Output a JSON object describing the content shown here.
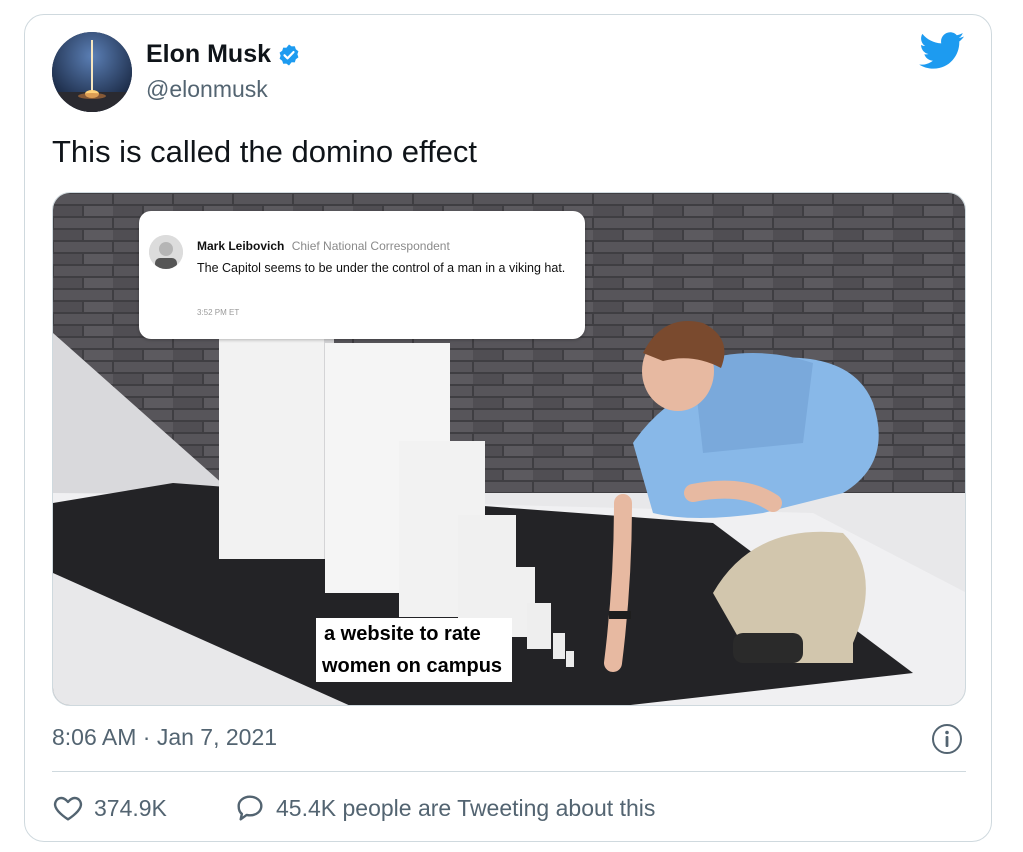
{
  "author": {
    "name": "Elon Musk",
    "handle": "@elonmusk",
    "verified_icon": "verified-badge-icon",
    "verified_color": "#1d9bf0"
  },
  "brand": {
    "icon": "twitter-bird-icon",
    "color": "#1d9bf0"
  },
  "tweet": {
    "text": "This is called the domino effect",
    "timestamp": "8:06 AM · Jan 7, 2021"
  },
  "media": {
    "quote": {
      "name": "Mark Leibovich",
      "title": "Chief National Correspondent",
      "body": "The Capitol seems to be under the control of a man in a viking hat.",
      "time": "3:52 PM ET"
    },
    "caption_lines": [
      "a website to rate",
      "women on campus"
    ]
  },
  "stats": {
    "likes": "374.9K",
    "tweeting": "45.4K people are Tweeting about this",
    "like_icon": "heart-icon",
    "reply_icon": "speech-bubble-icon"
  },
  "info_icon": "info-icon"
}
